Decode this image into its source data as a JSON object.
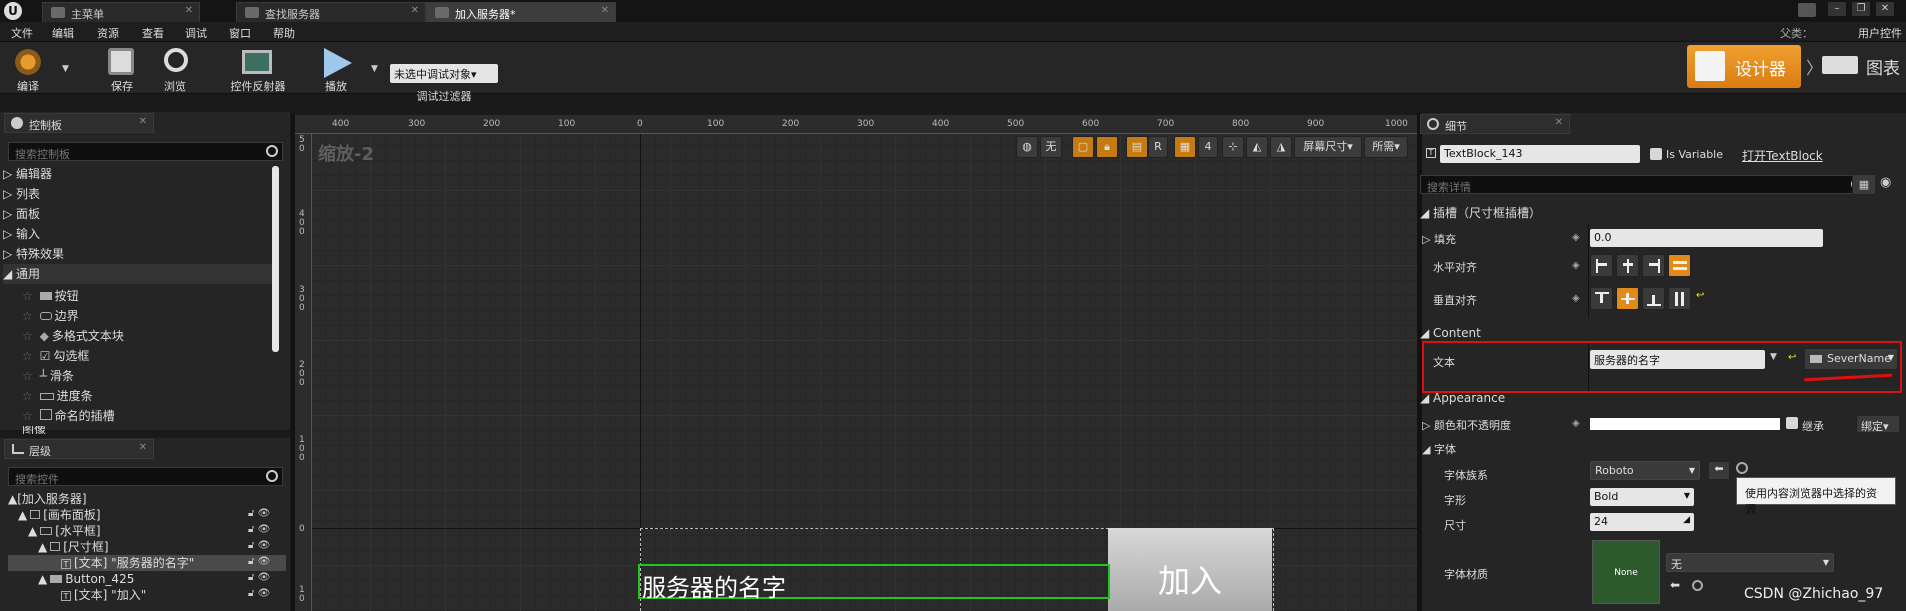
{
  "tabs": [
    {
      "label": "主菜单"
    },
    {
      "label": "查找服务器"
    },
    {
      "label": "加入服务器*"
    }
  ],
  "window": {
    "parent_label": "父类：",
    "parent_value": "用户控件"
  },
  "menu": [
    "文件",
    "编辑",
    "资源",
    "查看",
    "调试",
    "窗口",
    "帮助"
  ],
  "toolbar": {
    "compile": "编译",
    "save": "保存",
    "browse": "浏览",
    "reflector": "控件反射器",
    "play": "播放",
    "debug_select": "未选中调试对象▾",
    "debug_filter": "调试过滤器",
    "designer": "设计器",
    "graph": "图表"
  },
  "palette": {
    "tab": "控制板",
    "search_placeholder": "搜索控制板",
    "categories": [
      "编辑器",
      "列表",
      "面板",
      "输入",
      "特殊效果",
      "通用"
    ],
    "items": [
      "按钮",
      "边界",
      "多格式文本块",
      "勾选框",
      "滑条",
      "进度条",
      "命名的插槽",
      "图像"
    ]
  },
  "hierarchy": {
    "tab": "层级",
    "search_placeholder": "搜索控件",
    "items": [
      {
        "label": "[加入服务器]",
        "indent": 0
      },
      {
        "label": "[画布面板]",
        "indent": 1
      },
      {
        "label": "[水平框]",
        "indent": 2
      },
      {
        "label": "[尺寸框]",
        "indent": 3
      },
      {
        "label": "[文本] \"服务器的名字\"",
        "indent": 4
      },
      {
        "label": "Button_425",
        "indent": 3
      },
      {
        "label": "[文本] \"加入\"",
        "indent": 4
      }
    ]
  },
  "canvas": {
    "zoom_label": "缩放-2",
    "ruler_h": [
      "400",
      "300",
      "200",
      "100",
      "0",
      "100",
      "200",
      "300",
      "400",
      "500",
      "600",
      "700",
      "800",
      "900",
      "1000"
    ],
    "ruler_v": [
      "5\n0",
      "4\n0\n0",
      "3\n0\n0",
      "2\n0\n0",
      "1\n0\n0",
      "0",
      "1\n0"
    ],
    "btn_none": "无",
    "btn_r": "R",
    "btn_4": "4",
    "screen_size": "屏幕尺寸▾",
    "fill_mode": "所需▾",
    "text_widget": "服务器的名字",
    "join_button": "加入"
  },
  "details": {
    "tab": "细节",
    "widget_name": "TextBlock_143",
    "is_variable": "Is Variable",
    "open_link": "打开TextBlock",
    "search_placeholder": "搜索详情",
    "slot_section": "插槽（尺寸框插槽）",
    "padding_label": "填充",
    "padding_value": "0.0",
    "h_align": "水平对齐",
    "v_align": "垂直对齐",
    "content_section": "Content",
    "text_label": "文本",
    "text_value": "服务器的名字",
    "binding_value": "SeverName",
    "appearance_section": "Appearance",
    "color_label": "颜色和不透明度",
    "inherit": "继承",
    "bind": "绑定▾",
    "font_section": "字体",
    "font_family_label": "字体族系",
    "font_family_value": "Roboto",
    "typeface_label": "字形",
    "typeface_value": "Bold",
    "size_label": "尺寸",
    "size_value": "24",
    "material_label": "字体材质",
    "material_thumb": "None",
    "material_value": "无",
    "tooltip": "使用内容浏览器中选择的资源"
  },
  "watermark": "CSDN @Zhichao_97",
  "colors": {
    "accent": "#e08a1a",
    "highlight_red": "#e01010",
    "widget_green": "#22c422"
  }
}
